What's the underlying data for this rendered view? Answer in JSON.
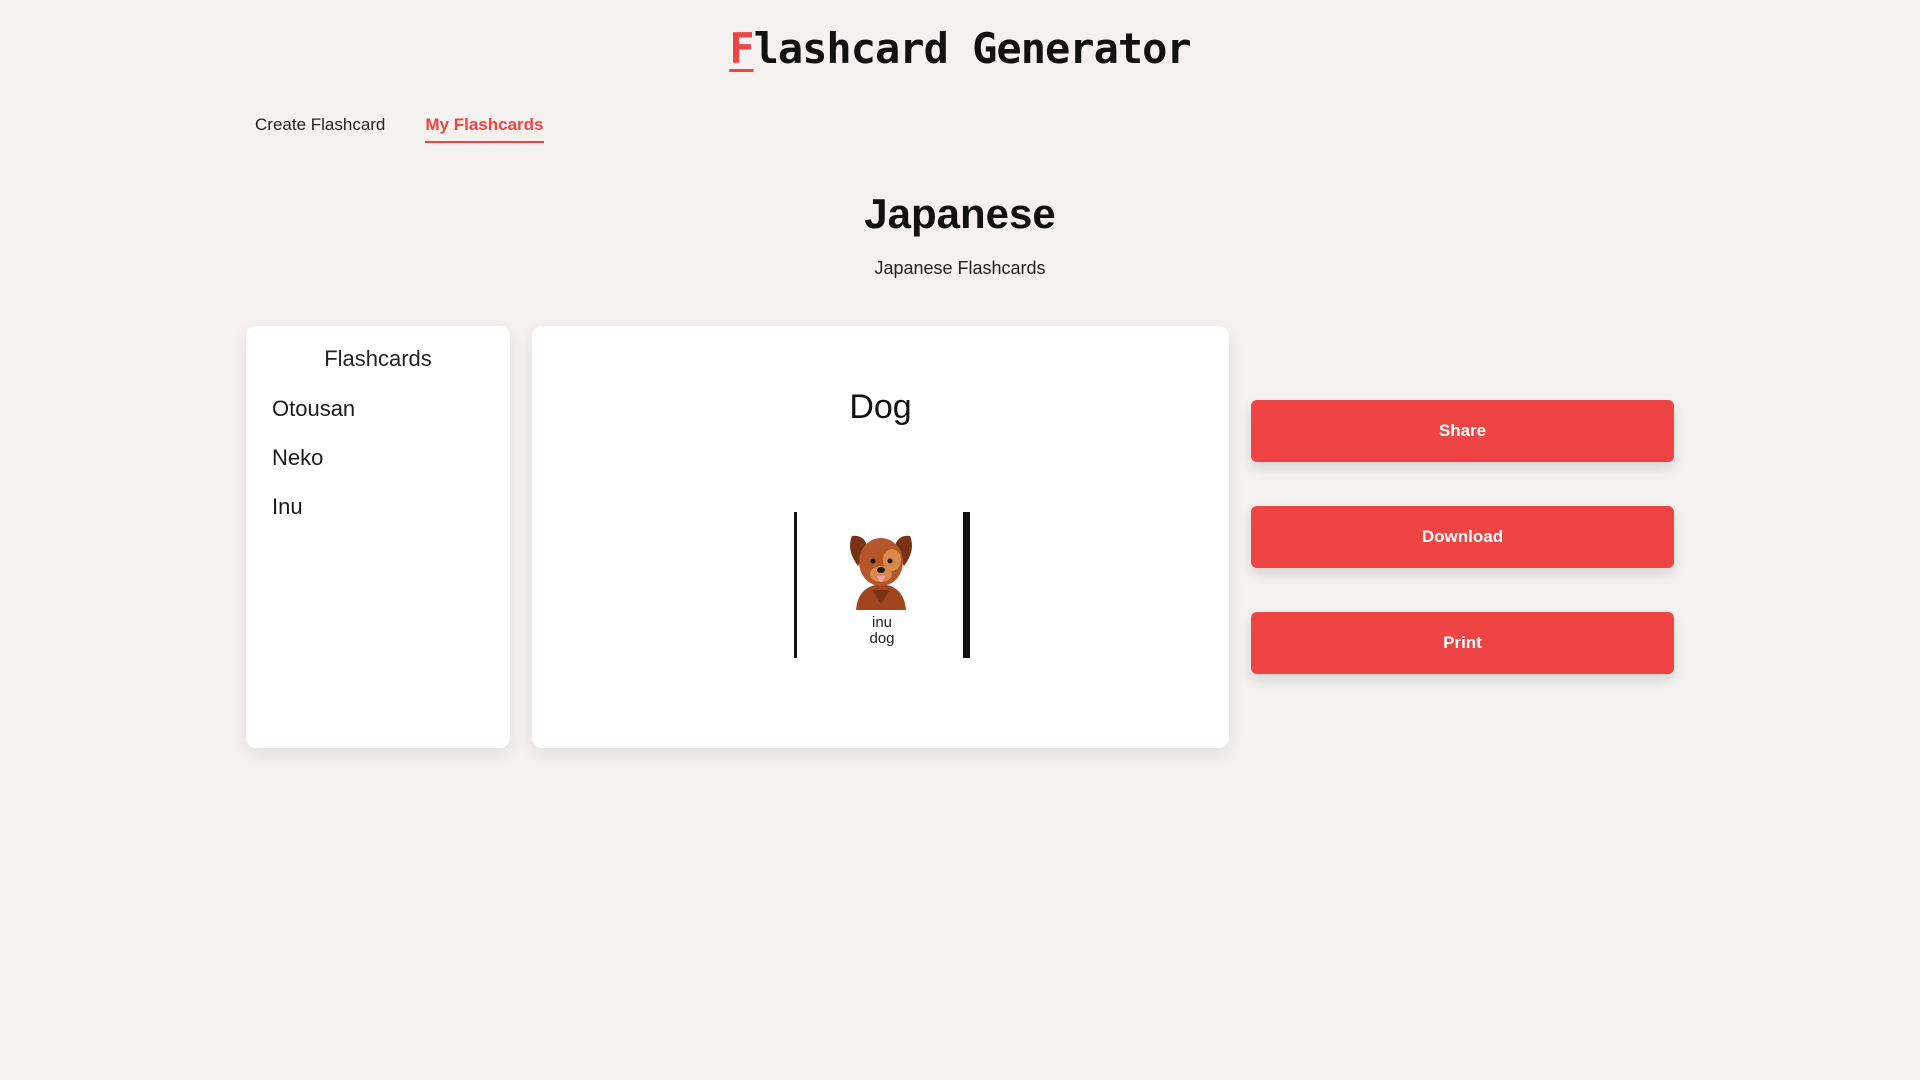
{
  "header": {
    "title_first_letter": "F",
    "title_rest": "lashcard Generator"
  },
  "nav": {
    "tabs": [
      {
        "label": "Create Flashcard",
        "active": false
      },
      {
        "label": "My Flashcards",
        "active": true
      }
    ]
  },
  "group": {
    "title": "Japanese",
    "description": "Japanese Flashcards"
  },
  "sidebar": {
    "heading": "Flashcards",
    "items": [
      {
        "label": "Otousan"
      },
      {
        "label": "Neko"
      },
      {
        "label": "Inu"
      }
    ]
  },
  "card": {
    "term": "Dog",
    "image_icon": "dog-icon",
    "caption_reading": "inu",
    "caption_meaning": "dog"
  },
  "actions": {
    "share_label": "Share",
    "download_label": "Download",
    "print_label": "Print"
  },
  "colors": {
    "accent": "#ef4444",
    "background": "#f5f1f1",
    "panel": "#ffffff"
  }
}
